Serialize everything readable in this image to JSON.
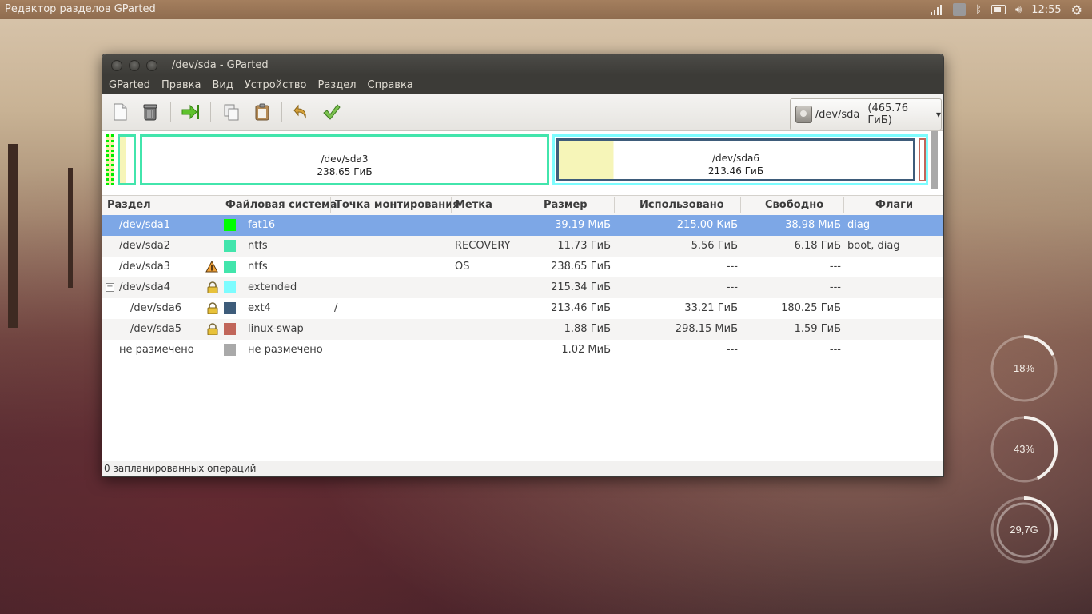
{
  "topbar": {
    "title": "Редактор разделов GParted",
    "clock": "12:55"
  },
  "window": {
    "title": "/dev/sda - GParted",
    "menu": [
      "GParted",
      "Правка",
      "Вид",
      "Устройство",
      "Раздел",
      "Справка"
    ],
    "device_selector": {
      "name": "/dev/sda",
      "size": "(465.76 ГиБ)"
    }
  },
  "diskmap": {
    "sda3": {
      "name": "/dev/sda3",
      "size": "238.65 ГиБ"
    },
    "sda6": {
      "name": "/dev/sda6",
      "size": "213.46 ГиБ"
    }
  },
  "table": {
    "columns": [
      "Раздел",
      "Файловая система",
      "Точка монтирования",
      "Метка",
      "Размер",
      "Использовано",
      "Свободно",
      "Флаги"
    ],
    "rows": [
      {
        "partition": "/dev/sda1",
        "fs": "fat16",
        "color": "#00ff00",
        "mount": "",
        "label": "",
        "size": "39.19 МиБ",
        "used": "215.00 КиБ",
        "free": "38.98 МиБ",
        "flags": "diag",
        "icon": "none",
        "selected": true
      },
      {
        "partition": "/dev/sda2",
        "fs": "ntfs",
        "color": "#42e5ac",
        "mount": "",
        "label": "RECOVERY",
        "size": "11.73 ГиБ",
        "used": "5.56 ГиБ",
        "free": "6.18 ГиБ",
        "flags": "boot, diag",
        "icon": "none"
      },
      {
        "partition": "/dev/sda3",
        "fs": "ntfs",
        "color": "#42e5ac",
        "mount": "",
        "label": "OS",
        "size": "238.65 ГиБ",
        "used": "---",
        "free": "---",
        "flags": "",
        "icon": "warning-icon"
      },
      {
        "partition": "/dev/sda4",
        "fs": "extended",
        "color": "#7dfcfe",
        "mount": "",
        "label": "",
        "size": "215.34 ГиБ",
        "used": "---",
        "free": "---",
        "flags": "",
        "icon": "lock-icon",
        "expander": "−"
      },
      {
        "partition": "/dev/sda6",
        "fs": "ext4",
        "color": "#3e5c7a",
        "mount": "/",
        "label": "",
        "size": "213.46 ГиБ",
        "used": "33.21 ГиБ",
        "free": "180.25 ГиБ",
        "flags": "",
        "icon": "lock-icon",
        "child": true
      },
      {
        "partition": "/dev/sda5",
        "fs": "linux-swap",
        "color": "#c1665a",
        "mount": "",
        "label": "",
        "size": "1.88 ГиБ",
        "used": "298.15 МиБ",
        "free": "1.59 ГиБ",
        "flags": "",
        "icon": "lock-icon",
        "child": true
      },
      {
        "partition": "не размечено",
        "fs": "не размечено",
        "color": "#a9a9a9",
        "mount": "",
        "label": "",
        "size": "1.02 МиБ",
        "used": "---",
        "free": "---",
        "flags": "",
        "icon": "none"
      }
    ]
  },
  "status": "0 запланированных операций",
  "conky": [
    {
      "text": "18%",
      "value": 0.18
    },
    {
      "text": "43%",
      "value": 0.43
    },
    {
      "text": "29,7G",
      "value": 0.3
    }
  ]
}
